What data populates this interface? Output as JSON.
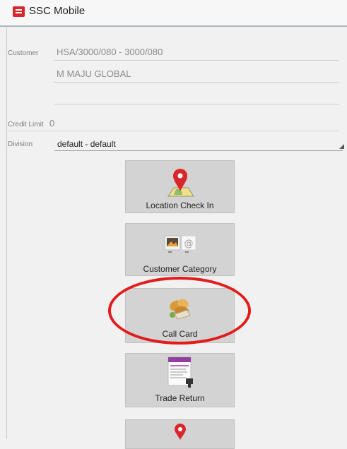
{
  "app": {
    "title": "SSC Mobile",
    "icon": "app-logo-icon"
  },
  "customer": {
    "label": "Customer",
    "code": "HSA/3000/080 - 3000/080",
    "name": "M MAJU GLOBAL",
    "address": ""
  },
  "credit_limit": {
    "label": "Credit Limit",
    "value": "0"
  },
  "division": {
    "label": "Division",
    "value": "default - default"
  },
  "menu": [
    {
      "label": "Location Check In",
      "icon": "map-pin-icon"
    },
    {
      "label": "Customer Category",
      "icon": "contact-card-icon"
    },
    {
      "label": "Call Card",
      "icon": "call-card-icon"
    },
    {
      "label": "Trade Return",
      "icon": "return-form-icon"
    },
    {
      "label": "",
      "icon": "map-pin-icon"
    }
  ],
  "colors": {
    "highlight": "#e21b1b",
    "tile": "#d3d3d3",
    "pin": "#d8262b"
  }
}
